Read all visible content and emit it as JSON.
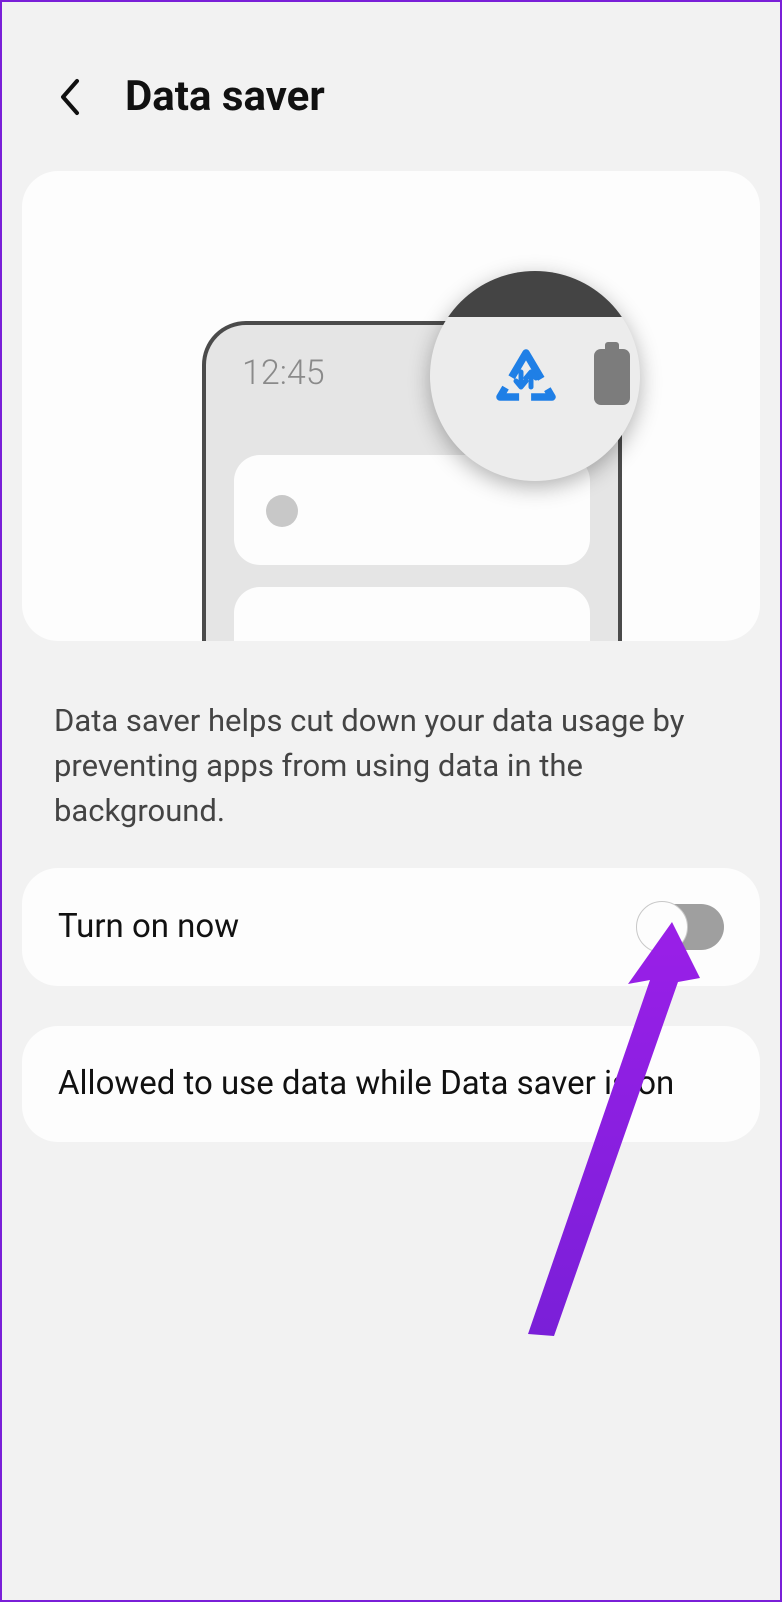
{
  "header": {
    "title": "Data saver"
  },
  "illustration": {
    "phone_time": "12:45"
  },
  "description": "Data saver helps cut down your data usage by preventing apps from using data in the background.",
  "rows": {
    "turn_on": {
      "label": "Turn on now",
      "enabled": false
    },
    "allowed": {
      "label": "Allowed to use data while Data saver is on"
    }
  }
}
